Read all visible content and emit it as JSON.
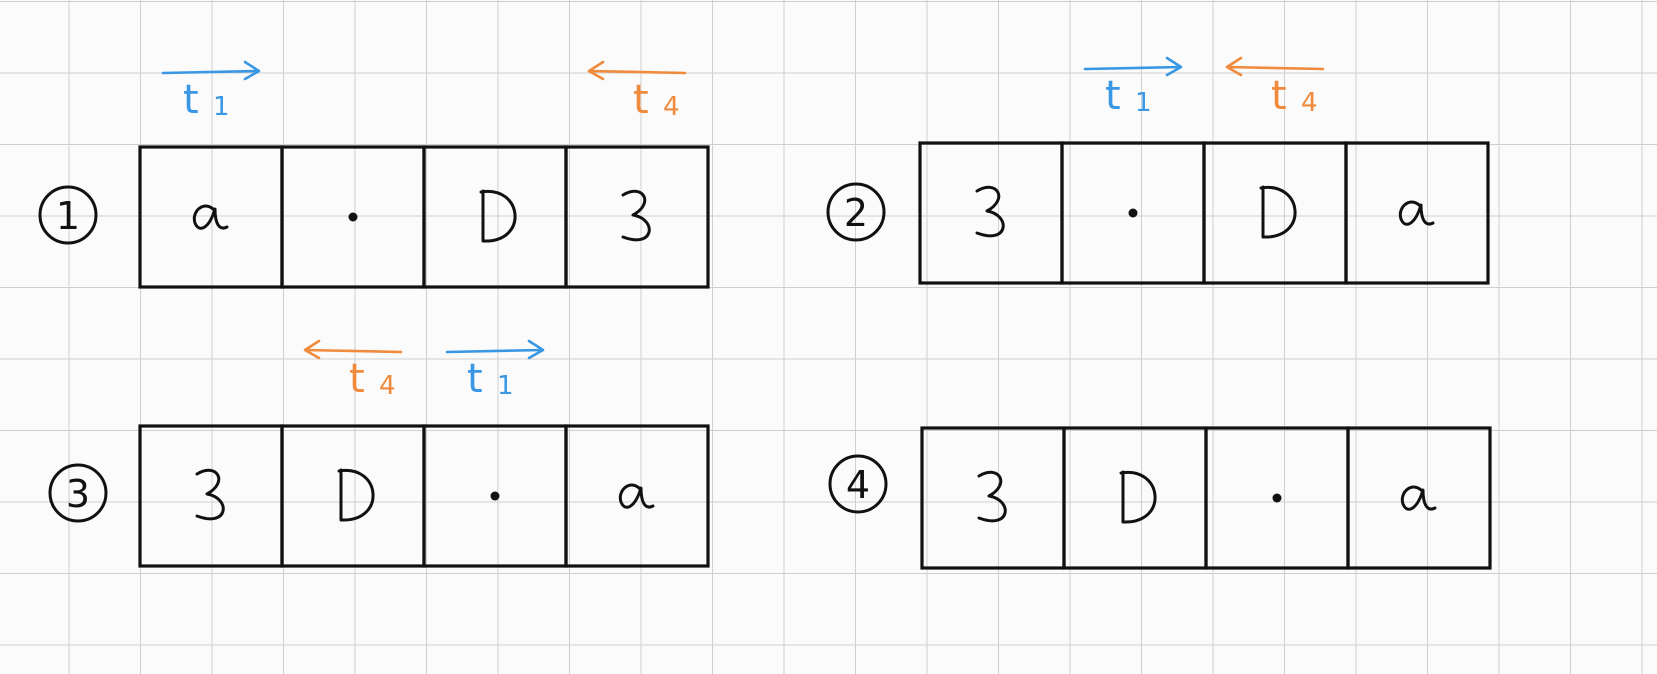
{
  "colors": {
    "ink": "#111111",
    "t1": "#3a97e3",
    "t4": "#f08a3c",
    "grid": "#cfcfcf",
    "paper": "#fbfbfb"
  },
  "panels": [
    {
      "number": "1",
      "cells": [
        "α",
        "•",
        "D",
        "3"
      ],
      "pointers": [
        {
          "label": "t",
          "sub": "1",
          "direction": "right",
          "color_key": "t1",
          "over_cell": 0
        },
        {
          "label": "t",
          "sub": "4",
          "direction": "left",
          "color_key": "t4",
          "over_cell": 3
        }
      ]
    },
    {
      "number": "2",
      "cells": [
        "3",
        "•",
        "D",
        "α"
      ],
      "pointers": [
        {
          "label": "t",
          "sub": "1",
          "direction": "right",
          "color_key": "t1",
          "over_cell": 1
        },
        {
          "label": "t",
          "sub": "4",
          "direction": "left",
          "color_key": "t4",
          "over_cell": 2
        }
      ]
    },
    {
      "number": "3",
      "cells": [
        "3",
        "D",
        "•",
        "α"
      ],
      "pointers": [
        {
          "label": "t",
          "sub": "4",
          "direction": "left",
          "color_key": "t4",
          "over_cell": 1
        },
        {
          "label": "t",
          "sub": "1",
          "direction": "right",
          "color_key": "t1",
          "over_cell": 2
        }
      ]
    },
    {
      "number": "4",
      "cells": [
        "3",
        "D",
        "•",
        "α"
      ],
      "pointers": []
    }
  ]
}
